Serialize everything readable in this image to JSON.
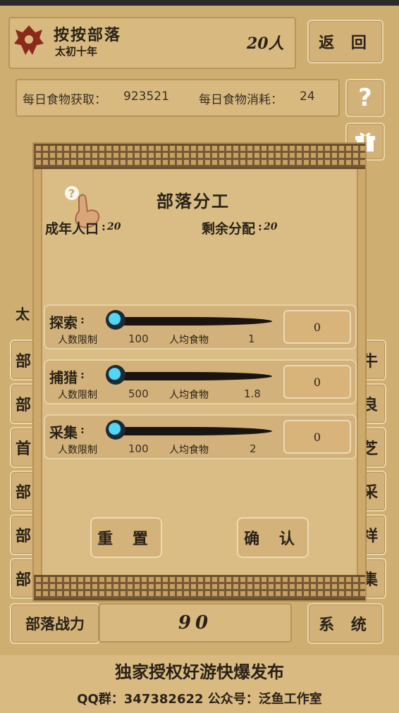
{
  "header": {
    "tribe_name": "按按部落",
    "era": "太初十年",
    "population": "20人",
    "back_label": "返 回"
  },
  "food_bar": {
    "gain_label": "每日食物获取：",
    "gain_value": "923521",
    "cost_label": "每日食物消耗：",
    "cost_value": "24",
    "help_icon": "question-icon"
  },
  "background_left_buttons": [
    "部",
    "部",
    "首",
    "部",
    "部",
    "部"
  ],
  "background_right_buttons": [
    "牛",
    "良",
    "芝",
    "采",
    "祥",
    "集"
  ],
  "background_partial_label": "太",
  "bottom_bar": {
    "power_label": "部落战力",
    "power_value": "90",
    "system_label": "系 统"
  },
  "modal": {
    "title": "部落分工",
    "adult_label": "成年人口",
    "adult_value": "20",
    "remaining_label": "剩余分配",
    "remaining_value": "20",
    "jobs": [
      {
        "name": "探索",
        "limit_label": "人数限制",
        "limit": "100",
        "food_label": "人均食物",
        "food": "1",
        "value": "0"
      },
      {
        "name": "捕猎",
        "limit_label": "人数限制",
        "limit": "500",
        "food_label": "人均食物",
        "food": "1.8",
        "value": "0"
      },
      {
        "name": "采集",
        "limit_label": "人数限制",
        "limit": "100",
        "food_label": "人均食物",
        "food": "2",
        "value": "0"
      }
    ],
    "reset_label": "重 置",
    "confirm_label": "确 认"
  },
  "footer": {
    "line1": "独家授权好游快爆发布",
    "line2": "QQ群：347382622 公众号：泛鱼工作室"
  },
  "colors": {
    "parchment": "#cfae72",
    "knob": "#52d6f5",
    "ink": "#1a1410"
  }
}
